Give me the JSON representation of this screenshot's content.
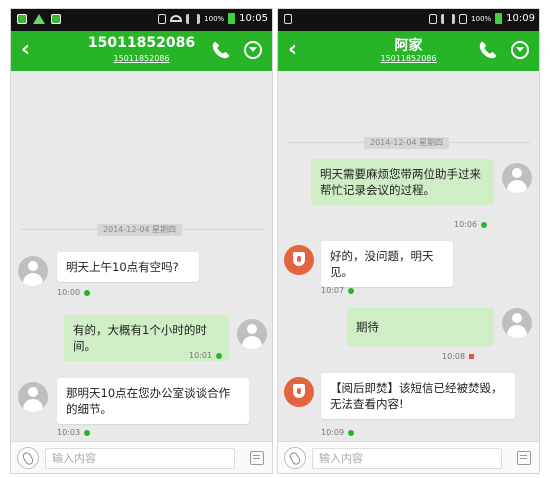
{
  "left": {
    "status": {
      "time": "10:05",
      "battery": "100%"
    },
    "header": {
      "title": "15011852086",
      "subtitle": "15011852086"
    },
    "date": "2014-12-04 星期四",
    "messages": [
      {
        "text": "明天上午10点有空吗?",
        "time": "10:00"
      },
      {
        "text": "有的，大概有1个小时的时间。",
        "time": "10:01"
      },
      {
        "text": "那明天10点在您办公室谈谈合作的细节。",
        "time": "10:03"
      }
    ],
    "input": {
      "placeholder": "输入内容"
    }
  },
  "right": {
    "status": {
      "time": "10:09",
      "battery": "100%"
    },
    "header": {
      "title": "阿家",
      "subtitle": "15011852086"
    },
    "date": "2014-12-04 星期四",
    "messages": [
      {
        "text": "明天需要麻烦您带两位助手过来帮忙记录会议的过程。",
        "time": "10:06"
      },
      {
        "text": "好的，没问题，明天见。",
        "time": "10:07"
      },
      {
        "text": "期待",
        "time": "10:08"
      },
      {
        "text": "【阅后即焚】该短信已经被焚毁，无法查看内容!",
        "time": "10:09"
      }
    ],
    "input": {
      "placeholder": "输入内容"
    }
  },
  "colors": {
    "header": "#27b427",
    "outgoing_bubble": "#cfeec6",
    "incoming_bubble": "#ffffff",
    "background": "#e9e9e9"
  }
}
